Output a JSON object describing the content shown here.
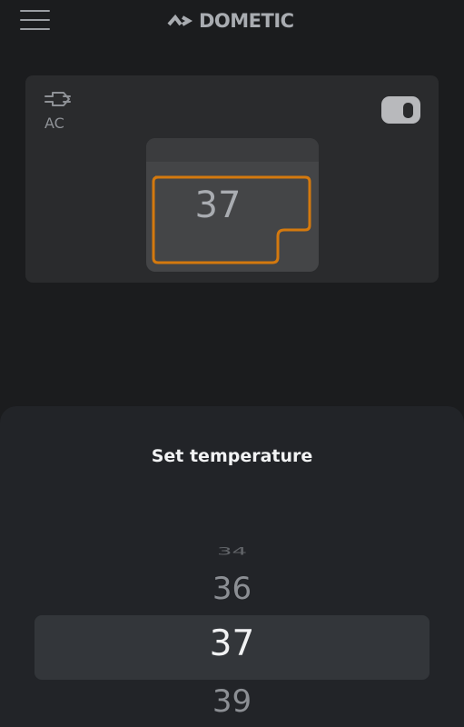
{
  "header": {
    "menu_icon": "hamburger-menu-icon",
    "brand": "DOMETIC",
    "brand_icon": "dometic-logo-icon"
  },
  "fridge_card": {
    "power_icon": "plug-icon",
    "power_source": "AC",
    "power_toggle": {
      "icon": "toggle-switch",
      "on": true
    },
    "compartment_temperature": "37",
    "accent_color": "#d4790e"
  },
  "temperature_sheet": {
    "title": "Set temperature",
    "picker": {
      "far_previous": "34",
      "previous": "36",
      "selected": "37",
      "next": "39"
    }
  }
}
